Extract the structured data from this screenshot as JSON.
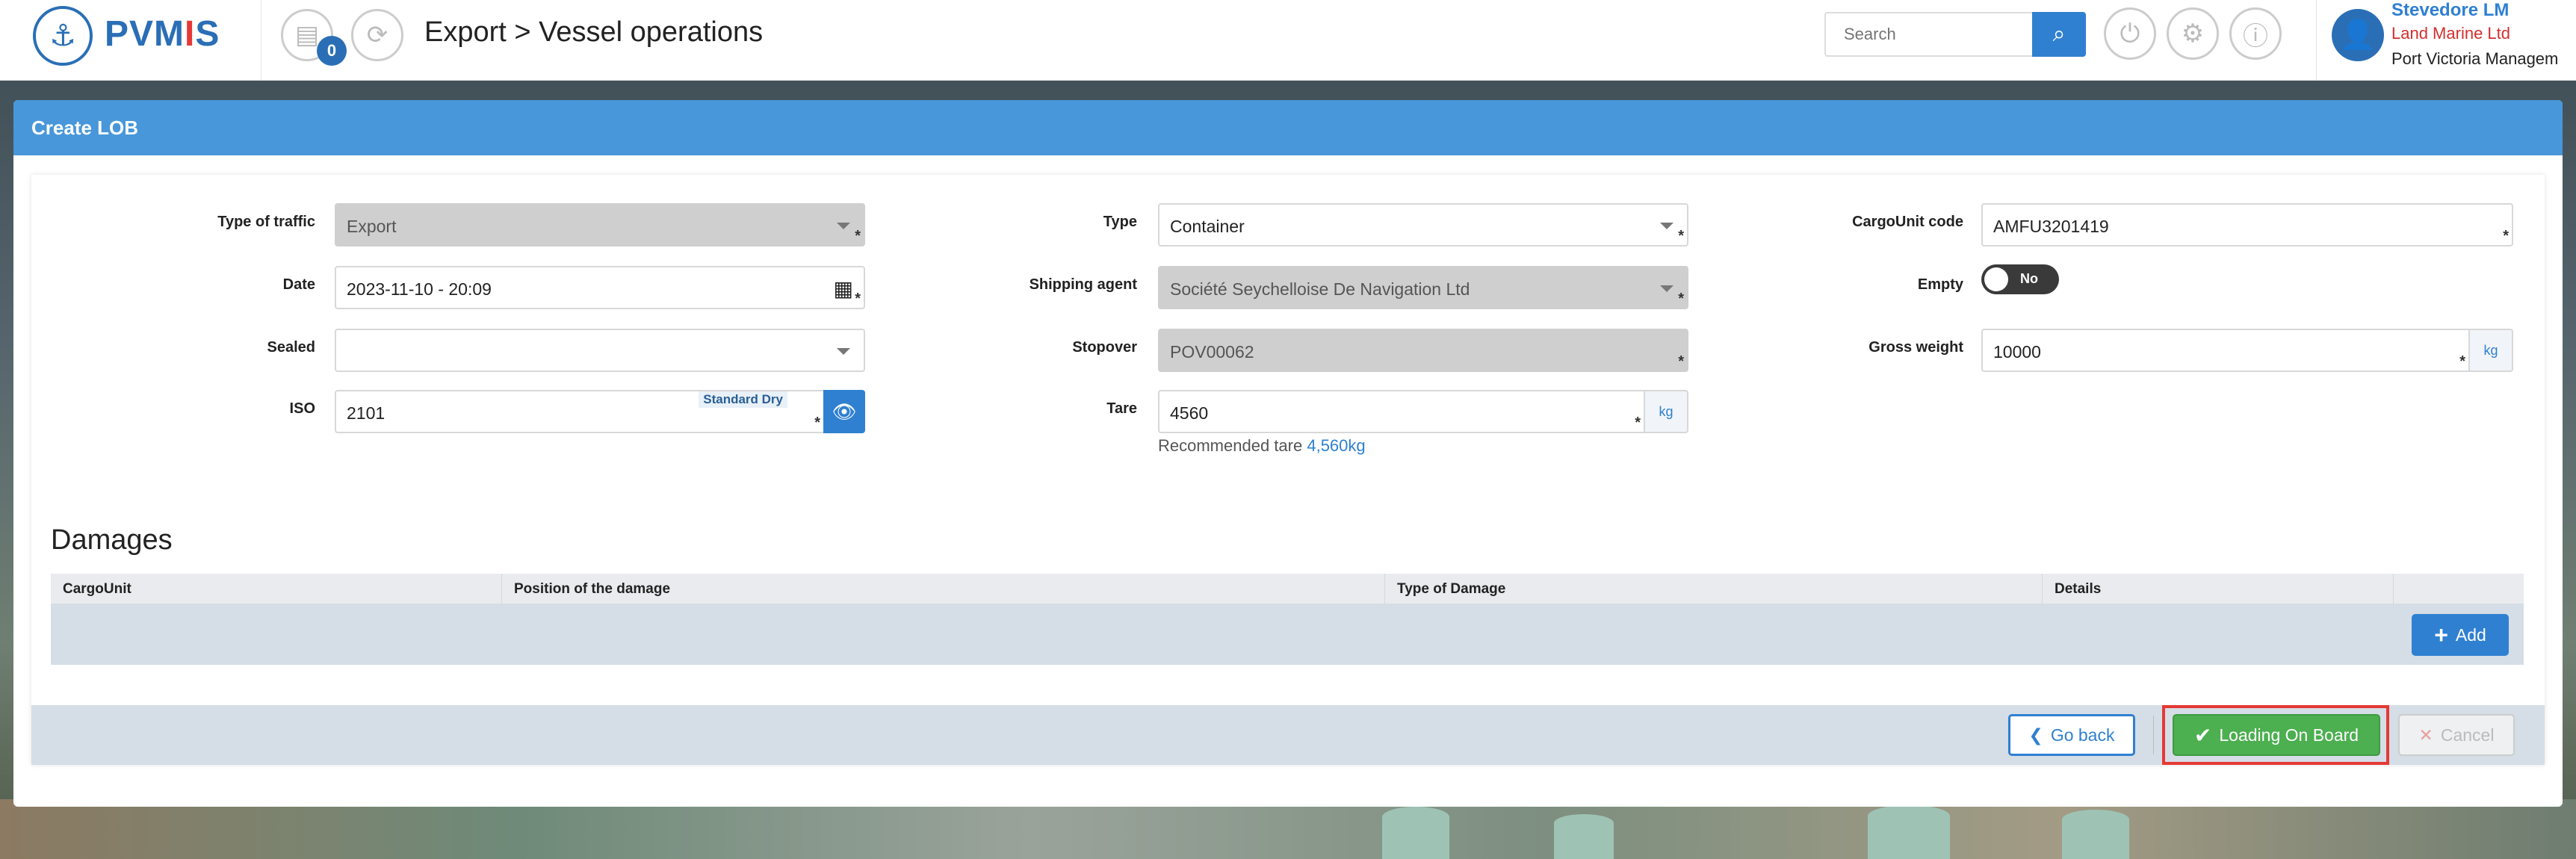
{
  "header": {
    "logo": {
      "text_main": "PVM",
      "text_accent": "I",
      "text_end": "S"
    },
    "notification_count": "0",
    "breadcrumb": "Export > Vessel operations",
    "search": {
      "placeholder": "Search"
    },
    "user": {
      "name": "Stevedore LM",
      "company": "Land Marine Ltd",
      "org": "Port Victoria Managem"
    }
  },
  "panel": {
    "title": "Create LOB"
  },
  "form": {
    "type_of_traffic": {
      "label": "Type of traffic",
      "value": "Export"
    },
    "date": {
      "label": "Date",
      "value": "2023-11-10 - 20:09"
    },
    "sealed": {
      "label": "Sealed",
      "value": ""
    },
    "iso": {
      "label": "ISO",
      "value": "2101",
      "tag": "Standard Dry"
    },
    "type": {
      "label": "Type",
      "value": "Container"
    },
    "shipping_agent": {
      "label": "Shipping agent",
      "value": "Société Seychelloise De Navigation Ltd"
    },
    "stopover": {
      "label": "Stopover",
      "value": "POV00062"
    },
    "tare": {
      "label": "Tare",
      "value": "4560",
      "unit": "kg",
      "recommended_prefix": "Recommended tare",
      "recommended_value": "4,560kg"
    },
    "cargo_unit_code": {
      "label": "CargoUnit code",
      "value": "AMFU3201419"
    },
    "empty": {
      "label": "Empty",
      "value": "No"
    },
    "gross_weight": {
      "label": "Gross weight",
      "value": "10000",
      "unit": "kg"
    },
    "required_mark": "*"
  },
  "damages": {
    "title": "Damages",
    "columns": [
      "CargoUnit",
      "Position of the damage",
      "Type of Damage",
      "Details"
    ],
    "add_label": "Add"
  },
  "actions": {
    "go_back": "Go back",
    "loading_on_board": "Loading On Board",
    "cancel": "Cancel"
  },
  "colors": {
    "primary": "#2f80d1",
    "header_blue": "#4797da",
    "success": "#4caf50",
    "highlight": "#e53935"
  }
}
